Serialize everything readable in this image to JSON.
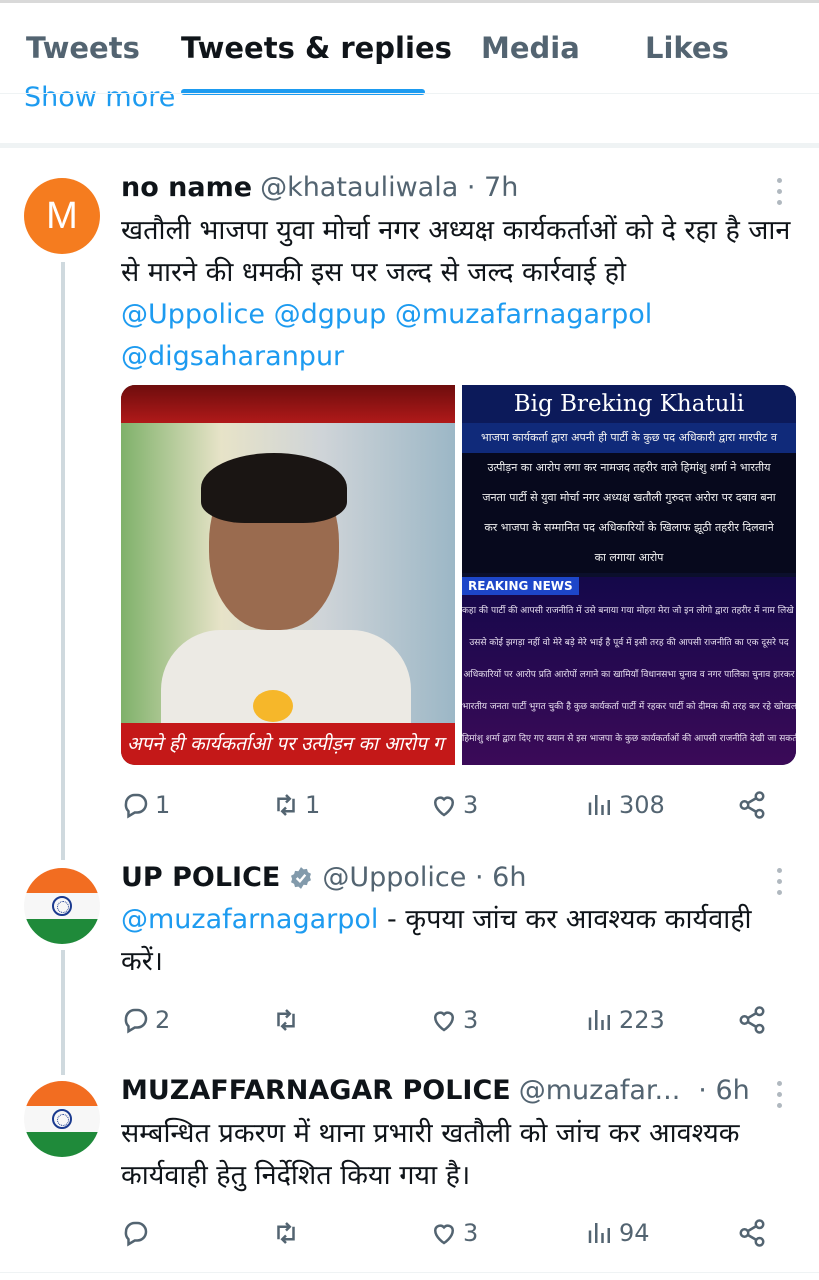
{
  "tabs": [
    "Tweets",
    "Tweets & replies",
    "Media",
    "Likes"
  ],
  "show_more": "Show more",
  "tweets": [
    {
      "avatar_letter": "M",
      "name": "no name",
      "handle": "@khatauliwala · 7h",
      "text": "खतौली भाजपा युवा मोर्चा नगर अध्यक्ष कार्यकर्ताओं को दे रहा है जान से मारने की धमकी इस पर जल्द से जल्द कार्रवाई हो",
      "mentions": "@Uppolice @dgpup @muzafarnagarpol @digsaharanpur",
      "media_left_caption": "अपने ही कार्यकर्ताओ पर उत्पीड़न का आरोप ग",
      "media_right_title": "Big Breking Khatuli",
      "media_right_lines": [
        "भाजपा कार्यकर्ता द्वारा अपनी ही पार्टी के कुछ पद अधिकारी द्वारा मारपीट व",
        "उत्पीड़न का आरोप लगा कर नामजद तहरीर वाले हिमांशु शर्मा ने भारतीय",
        "जनता पार्टी से युवा मोर्चा नगर अध्यक्ष खतौली गुरुदत्त अरोरा पर दबाव बना",
        "कर भाजपा के सम्मानित पद अधिकारियों के खिलाफ झूठी तहरीर दिलवाने",
        "का लगाया आरोप"
      ],
      "media_right_breaking": "REAKING NEWS",
      "media_right_small": [
        "कहा की पार्टी की आपसी राजनीति में उसे बनाया गया मोहरा मेरा जो इन लोगो द्वारा तहरीर में नाम लिखे गए",
        "उससे कोई झगड़ा नहीं वो मेरे बड़े मेरे भाई है पूर्व में इसी तरह की आपसी राजनीति का एक दूसरे पद",
        "अधिकारियों पर आरोप प्रति आरोपों लगाने का खामियाँ विधानसभा चुनाव व नगर पालिका चुनाव हारकर",
        "भारतीय जनता पार्टी भुगत चुकी है कुछ कार्यकर्ता पार्टी में रहकर पार्टी को दीमक की तरह कर रहे खोखला",
        "हिमांशु शर्मा द्वारा दिए गए बयान से इस भाजपा के कुछ कार्यकर्ताओं की आपसी राजनीति देखी जा सकती है"
      ],
      "replies": "1",
      "retweets": "1",
      "likes": "3",
      "views": "308"
    },
    {
      "name": "UP POLICE",
      "handle": "@Uppolice · 6h",
      "mention": "@muzafarnagarpol",
      "text": " - कृपया जांच कर आवश्यक कार्यवाही करें।",
      "replies": "2",
      "retweets": "",
      "likes": "3",
      "views": "223"
    },
    {
      "name": "MUZAFFARNAGAR POLICE",
      "handle": "@muzafar...",
      "time": "· 6h",
      "text": "सम्बन्धित प्रकरण में थाना प्रभारी खतौली को जांच कर आवश्यक कार्यवाही हेतु निर्देशित किया गया है।",
      "replies": "",
      "retweets": "",
      "likes": "3",
      "views": "94"
    }
  ],
  "colors": {
    "accent": "#1d9bf0",
    "text": "#0f1419",
    "muted": "#536471",
    "avatar_m": "#f57c1f"
  }
}
